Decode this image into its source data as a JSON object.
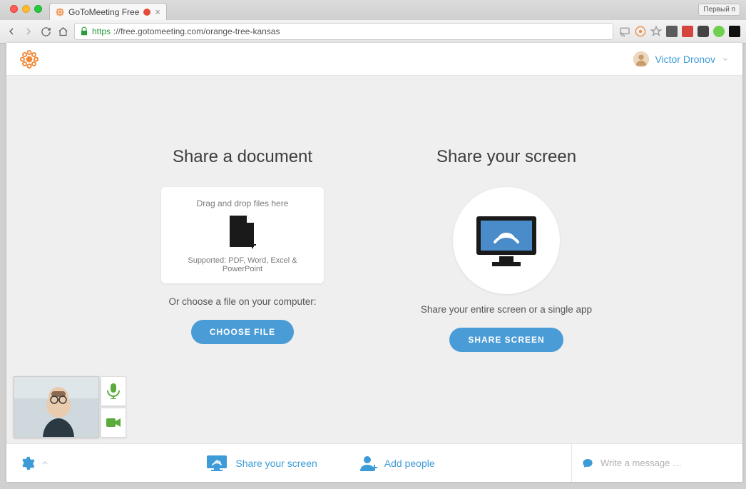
{
  "browser": {
    "tab_title": "GoToMeeting Free",
    "bookmark_label": "Первый п",
    "url_https": "https",
    "url_rest": "://free.gotomeeting.com/orange-tree-kansas"
  },
  "header": {
    "user_name": "Victor Dronov"
  },
  "share_doc": {
    "title": "Share a document",
    "drop_hint": "Drag and drop files here",
    "supported": "Supported: PDF, Word, Excel & PowerPoint",
    "subtext": "Or choose a file on your computer:",
    "button": "CHOOSE FILE"
  },
  "share_screen": {
    "title": "Share your screen",
    "subtext": "Share your entire screen or a single app",
    "button": "SHARE SCREEN"
  },
  "bottom": {
    "share_screen": "Share your screen",
    "add_people": "Add people",
    "message_placeholder": "Write a message …"
  }
}
